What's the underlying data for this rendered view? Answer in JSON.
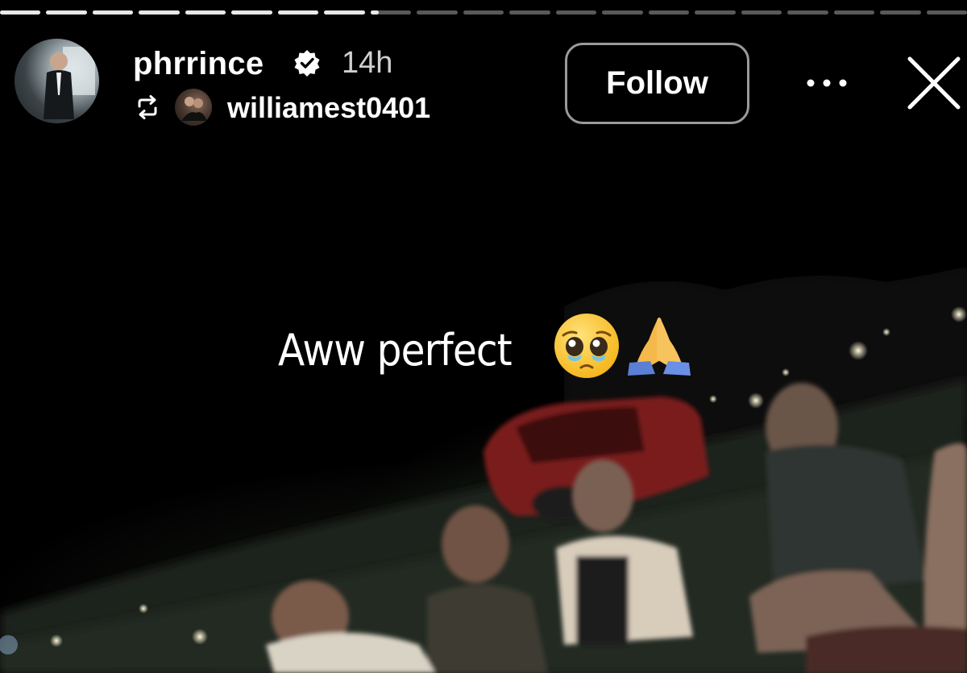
{
  "progress": {
    "segments_total": 21,
    "segments_completed": 8,
    "current_fraction": 0.2
  },
  "header": {
    "username": "phrrince",
    "verified": true,
    "time_ago": "14h",
    "repost_username": "williamest0401",
    "follow_label": "Follow"
  },
  "icons": {
    "verified": "verified-badge-icon",
    "repost": "repost-icon",
    "more": "more-dots-icon",
    "close": "close-icon"
  },
  "caption": {
    "text": "Aww perfect",
    "emojis": [
      "pleading-face",
      "folded-hands"
    ]
  },
  "colors": {
    "background": "#000000",
    "text": "#ffffff",
    "follow_border": "#9a9a9a",
    "muted_text": "#cfcfcf"
  }
}
